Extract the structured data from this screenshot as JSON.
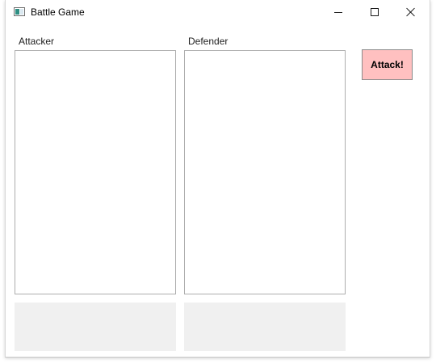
{
  "window": {
    "title": "Battle Game",
    "icon": "app-window-icon",
    "controls": {
      "minimize_icon": "minimize-icon",
      "maximize_icon": "maximize-icon",
      "close_icon": "close-icon"
    }
  },
  "attacker": {
    "label": "Attacker",
    "items": []
  },
  "defender": {
    "label": "Defender",
    "items": []
  },
  "actions": {
    "attack_label": "Attack!"
  },
  "colors": {
    "attack_button_bg": "#ffc0c0",
    "status_panel_bg": "#f0f0f0",
    "list_border": "#adadad"
  }
}
